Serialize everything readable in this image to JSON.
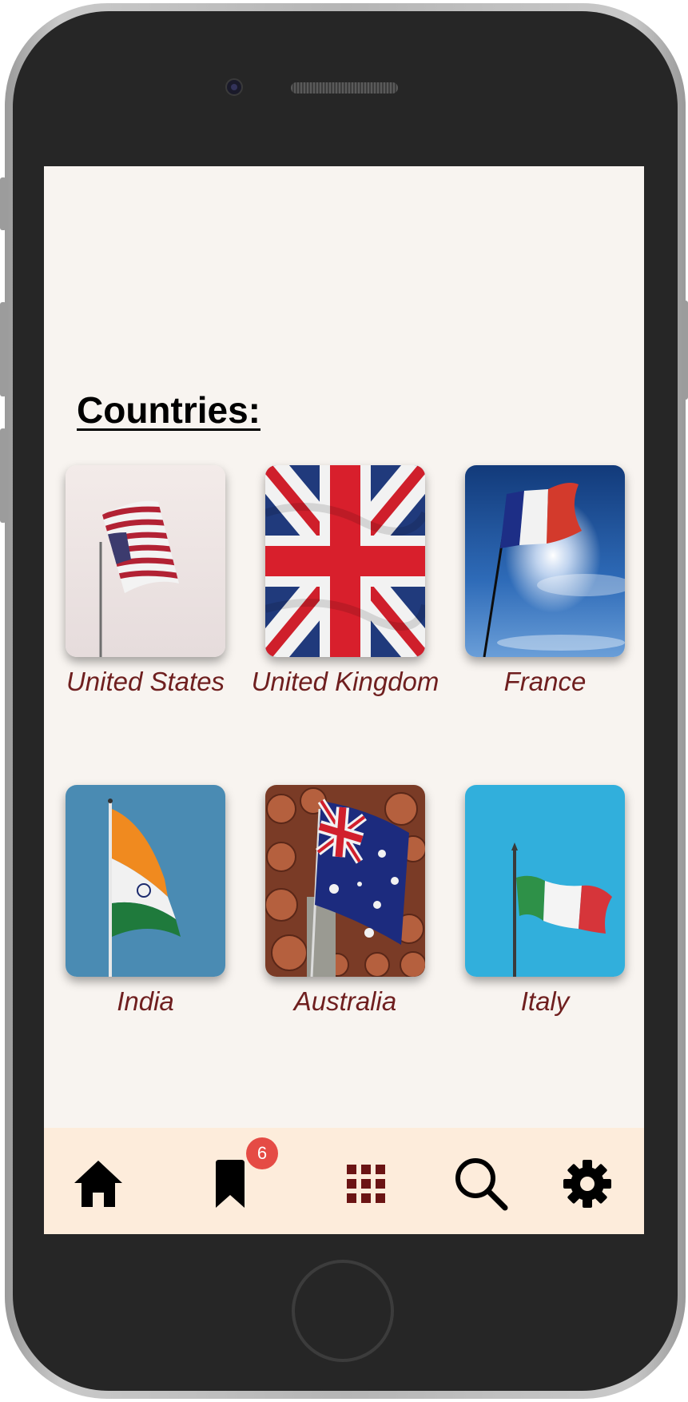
{
  "page": {
    "heading": "Countries:"
  },
  "countries": [
    {
      "name": "United States"
    },
    {
      "name": "United Kingdom"
    },
    {
      "name": "France"
    },
    {
      "name": "India"
    },
    {
      "name": "Australia"
    },
    {
      "name": "Italy"
    }
  ],
  "tabbar": {
    "items": [
      {
        "icon": "home-icon"
      },
      {
        "icon": "bookmark-icon",
        "badge": "6"
      },
      {
        "icon": "grid-icon"
      },
      {
        "icon": "search-icon"
      },
      {
        "icon": "gear-icon"
      }
    ]
  },
  "colors": {
    "label": "#6f1f1f",
    "background": "#f8f4f0",
    "tabbar": "#fdecdb",
    "badge": "#e54b45",
    "grid_icon": "#6b1414"
  }
}
